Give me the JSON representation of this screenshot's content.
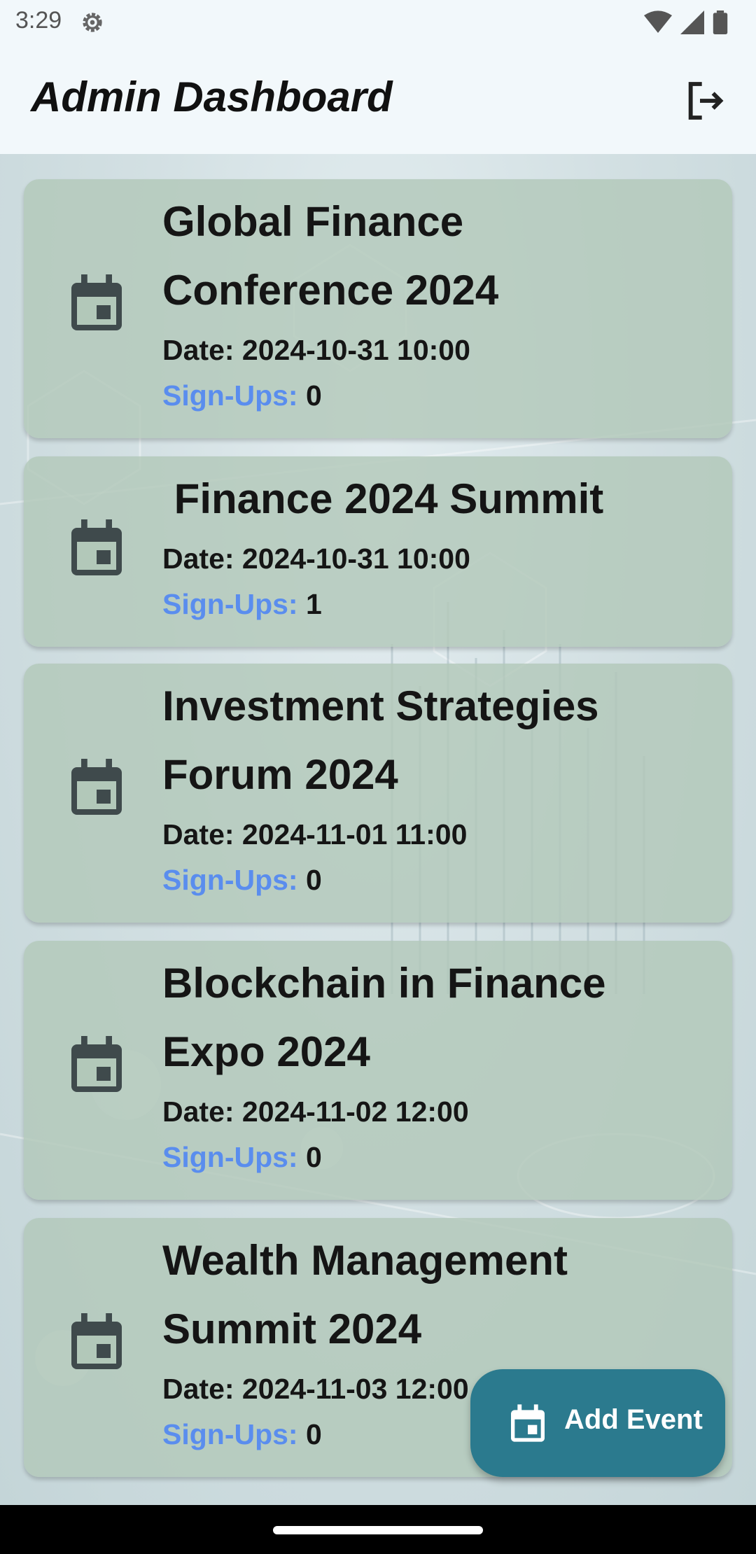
{
  "status_bar": {
    "time": "3:29"
  },
  "app_bar": {
    "title": "Admin Dashboard"
  },
  "events": [
    {
      "name_lines": [
        "Global Finance",
        "Conference 2024"
      ],
      "date": "Date: 2024-10-31 10:00",
      "signups_label": "Sign-Ups:",
      "signups": "0"
    },
    {
      "name_lines": [
        " Finance 2024 Summit"
      ],
      "date": "Date: 2024-10-31 10:00",
      "signups_label": "Sign-Ups:",
      "signups": "1"
    },
    {
      "name_lines": [
        "Investment Strategies",
        "Forum 2024"
      ],
      "date": "Date: 2024-11-01 11:00",
      "signups_label": "Sign-Ups:",
      "signups": "0"
    },
    {
      "name_lines": [
        "Blockchain in Finance",
        "Expo 2024"
      ],
      "date": "Date: 2024-11-02 12:00",
      "signups_label": "Sign-Ups:",
      "signups": "0"
    },
    {
      "name_lines": [
        "Wealth Management",
        "Summit 2024"
      ],
      "date": "Date: 2024-11-03 12:00",
      "signups_label": "Sign-Ups:",
      "signups": "0"
    }
  ],
  "fab": {
    "label": "Add Event",
    "icon": "calendar-icon"
  },
  "icons": {
    "status": [
      "settings-gear-icon",
      "wifi-icon",
      "signal-icon",
      "battery-icon"
    ],
    "app_bar_action": "logout-icon",
    "event": "calendar-icon"
  },
  "colors": {
    "signups_label": "#5a8dee",
    "fab_background": "#2b7a8e",
    "card_background": "#b2c8b9"
  }
}
